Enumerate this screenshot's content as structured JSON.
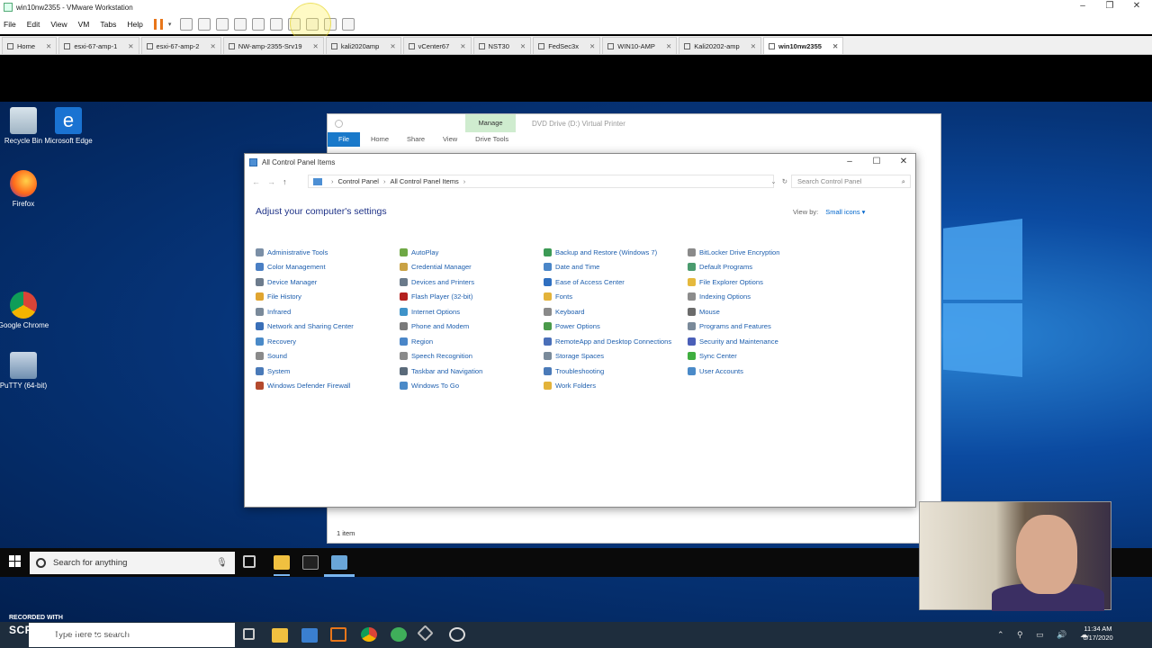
{
  "vmware": {
    "title": "win10nw2355 - VMware Workstation",
    "menu": [
      "File",
      "Edit",
      "View",
      "VM",
      "Tabs",
      "Help"
    ],
    "tabs": [
      {
        "label": "Home",
        "active": false
      },
      {
        "label": "esxi-67-amp-1",
        "active": false
      },
      {
        "label": "esxi-67-amp-2",
        "active": false
      },
      {
        "label": "NW-amp-2355-Srv19",
        "active": false
      },
      {
        "label": "kali2020amp",
        "active": false
      },
      {
        "label": "vCenter67",
        "active": false
      },
      {
        "label": "NST30",
        "active": false
      },
      {
        "label": "FedSec3x",
        "active": false
      },
      {
        "label": "WIN10-AMP",
        "active": false
      },
      {
        "label": "Kali20202-amp",
        "active": false
      },
      {
        "label": "win10nw2355",
        "active": true
      }
    ]
  },
  "desktop_icons": [
    {
      "label": "Recycle Bin",
      "icon": "recycle-bin-icon"
    },
    {
      "label": "Microsoft Edge",
      "icon": "edge-icon"
    },
    {
      "label": "Firefox",
      "icon": "firefox-icon"
    },
    {
      "label": "Google Chrome",
      "icon": "chrome-icon"
    },
    {
      "label": "PuTTY (64-bit)",
      "icon": "putty-icon"
    }
  ],
  "explorer_back": {
    "manage_tab": "Manage",
    "title": "DVD Drive (D:) Virtual Printer",
    "ribbon": [
      "File",
      "Home",
      "Share",
      "View",
      "Drive Tools"
    ],
    "status": "1 item"
  },
  "control_panel": {
    "title": "All Control Panel Items",
    "breadcrumb": [
      "Control Panel",
      "All Control Panel Items"
    ],
    "search_placeholder": "Search Control Panel",
    "heading": "Adjust your computer's settings",
    "view_by_label": "View by:",
    "view_by_value": "Small icons ▾",
    "items": [
      {
        "label": "Administrative Tools",
        "color": "#7b8fa6"
      },
      {
        "label": "AutoPlay",
        "color": "#6fa845"
      },
      {
        "label": "Backup and Restore (Windows 7)",
        "color": "#3c9a55"
      },
      {
        "label": "BitLocker Drive Encryption",
        "color": "#8a8a8a"
      },
      {
        "label": "Color Management",
        "color": "#4a7fc4"
      },
      {
        "label": "Credential Manager",
        "color": "#c9a244"
      },
      {
        "label": "Date and Time",
        "color": "#4a86c8"
      },
      {
        "label": "Default Programs",
        "color": "#4a9b6e"
      },
      {
        "label": "Device Manager",
        "color": "#6d7c8d"
      },
      {
        "label": "Devices and Printers",
        "color": "#6a7a8a"
      },
      {
        "label": "Ease of Access Center",
        "color": "#2f6fc0"
      },
      {
        "label": "File Explorer Options",
        "color": "#e5b93d"
      },
      {
        "label": "File History",
        "color": "#e0a531"
      },
      {
        "label": "Flash Player (32-bit)",
        "color": "#b3211e"
      },
      {
        "label": "Fonts",
        "color": "#e3b33a"
      },
      {
        "label": "Indexing Options",
        "color": "#8c8c8c"
      },
      {
        "label": "Infrared",
        "color": "#7a8a9a"
      },
      {
        "label": "Internet Options",
        "color": "#3f93c9"
      },
      {
        "label": "Keyboard",
        "color": "#8a8a8a"
      },
      {
        "label": "Mouse",
        "color": "#6b6b6b"
      },
      {
        "label": "Network and Sharing Center",
        "color": "#3a6fb8"
      },
      {
        "label": "Phone and Modem",
        "color": "#7a7a7a"
      },
      {
        "label": "Power Options",
        "color": "#4a9a4a"
      },
      {
        "label": "Programs and Features",
        "color": "#7a8a9a"
      },
      {
        "label": "Recovery",
        "color": "#4a8ac8"
      },
      {
        "label": "Region",
        "color": "#4a86c8"
      },
      {
        "label": "RemoteApp and Desktop Connections",
        "color": "#4a6fb8"
      },
      {
        "label": "Security and Maintenance",
        "color": "#4a5fb8"
      },
      {
        "label": "Sound",
        "color": "#8a8a8a"
      },
      {
        "label": "Speech Recognition",
        "color": "#8a8a8a"
      },
      {
        "label": "Storage Spaces",
        "color": "#7a8a9a"
      },
      {
        "label": "Sync Center",
        "color": "#3fae3f"
      },
      {
        "label": "System",
        "color": "#4a7ab8"
      },
      {
        "label": "Taskbar and Navigation",
        "color": "#5a6a7a"
      },
      {
        "label": "Troubleshooting",
        "color": "#4a7ab8"
      },
      {
        "label": "User Accounts",
        "color": "#4a8ac8"
      },
      {
        "label": "Windows Defender Firewall",
        "color": "#b44a2e"
      },
      {
        "label": "Windows To Go",
        "color": "#4a8ac8"
      },
      {
        "label": "Work Folders",
        "color": "#e3b33a"
      }
    ]
  },
  "guest_taskbar": {
    "search_placeholder": "Search for anything"
  },
  "host": {
    "search_placeholder": "Type here to search",
    "watermark_top": "RECORDED WITH",
    "watermark_brand": "SCREENCAST ◯ MATIC",
    "clock_time": "11:34 AM",
    "clock_date": "6/17/2020"
  }
}
